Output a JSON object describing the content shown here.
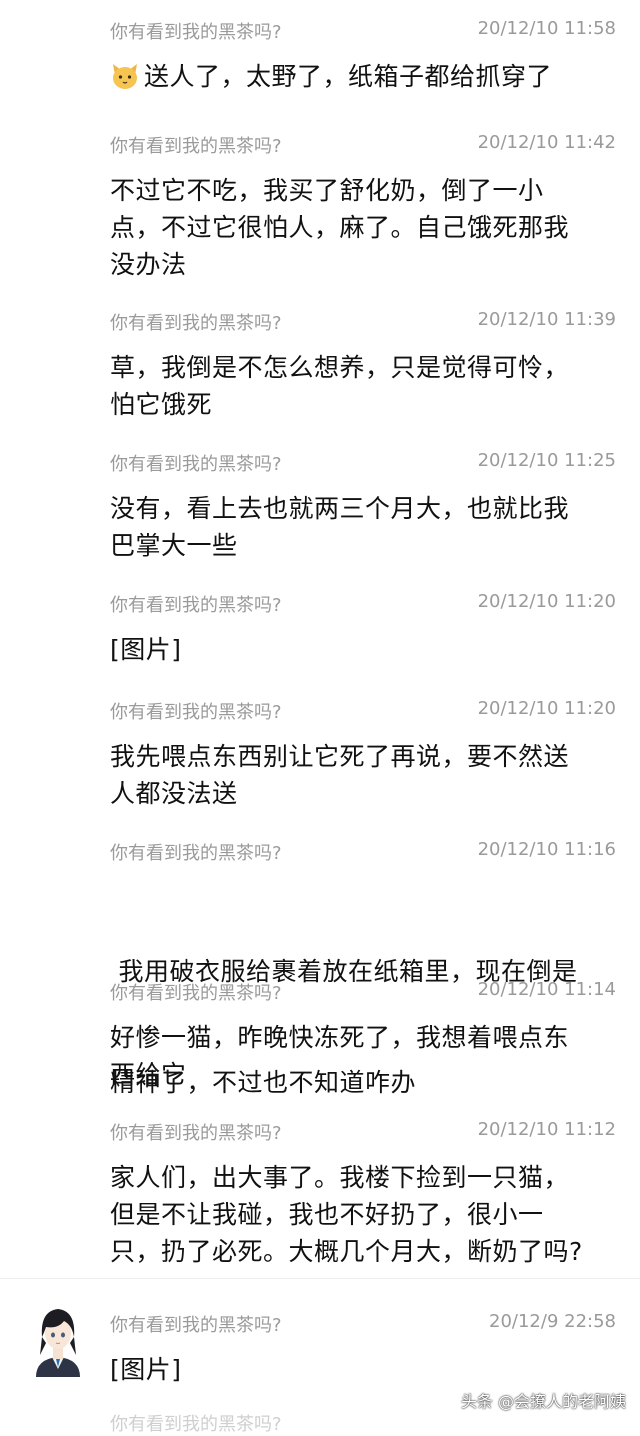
{
  "messages": [
    {
      "sender": "你有看到我的黑茶吗?",
      "time": "20/12/10 11:58",
      "text": "送人了，太野了，纸箱子都给抓穿了",
      "emoji": "cat-face"
    },
    {
      "sender": "你有看到我的黑茶吗?",
      "time": "20/12/10 11:42",
      "lines": [
        "不过它不吃，我买了舒化奶，倒了一小",
        "点，不过它很怕人，麻了。自己饿死那我",
        "没办法"
      ]
    },
    {
      "sender": "你有看到我的黑茶吗?",
      "time": "20/12/10 11:39",
      "lines": [
        "草，我倒是不怎么想养，只是觉得可怜，",
        "怕它饿死"
      ]
    },
    {
      "sender": "你有看到我的黑茶吗?",
      "time": "20/12/10 11:25",
      "lines": [
        "没有，看上去也就两三个月大，也就比我",
        "巴掌大一些"
      ]
    },
    {
      "sender": "你有看到我的黑茶吗?",
      "time": "20/12/10 11:20",
      "lines": [
        "[图片]"
      ]
    },
    {
      "sender": "你有看到我的黑茶吗?",
      "time": "20/12/10 11:20",
      "lines": [
        "我先喂点东西别让它死了再说，要不然送",
        "人都没法送"
      ]
    },
    {
      "sender": "你有看到我的黑茶吗?",
      "time": "20/12/10 11:16",
      "lines": [
        " 我用破衣服给裹着放在纸箱里，现在倒是",
        "精神了，不过也不知道咋办"
      ]
    },
    {
      "sender": "你有看到我的黑茶吗?",
      "time": "20/12/10 11:14",
      "lines": [
        "好惨一猫，昨晚快冻死了，我想着喂点东",
        "西给它"
      ]
    },
    {
      "sender": "你有看到我的黑茶吗?",
      "time": "20/12/10 11:12",
      "lines": [
        "家人们，出大事了。我楼下捡到一只猫，",
        "但是不让我碰，我也不好扔了，很小一",
        "只，扔了必死。大概几个月大，断奶了吗?"
      ]
    },
    {
      "sender": "你有看到我的黑茶吗?",
      "time": "20/12/9 22:58",
      "lines": [
        "[图片]"
      ]
    }
  ],
  "partial_next": {
    "sender": "你有看到我的黑茶吗?"
  },
  "watermark": "头条 @会撩人的老阿姨"
}
